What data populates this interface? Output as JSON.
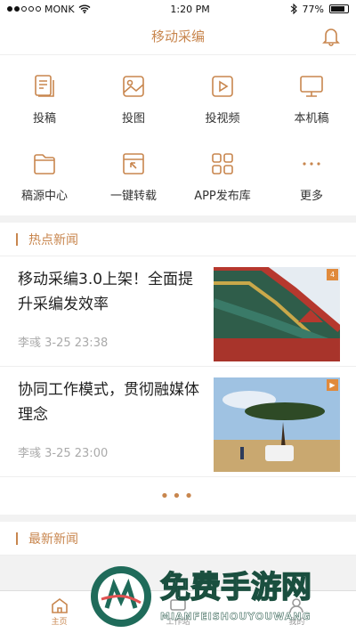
{
  "status": {
    "carrier": "MONK",
    "time": "1:20 PM",
    "battery": "77%",
    "battery_level": 0.77
  },
  "header": {
    "title": "移动采编"
  },
  "grid": [
    {
      "label": "投稿",
      "icon": "document-edit-icon"
    },
    {
      "label": "投图",
      "icon": "image-icon"
    },
    {
      "label": "投视频",
      "icon": "video-play-icon"
    },
    {
      "label": "本机稿",
      "icon": "monitor-icon"
    },
    {
      "label": "稿源中心",
      "icon": "folder-icon"
    },
    {
      "label": "一键转载",
      "icon": "repost-icon"
    },
    {
      "label": "APP发布库",
      "icon": "app-grid-icon"
    },
    {
      "label": "更多",
      "icon": "more-dots-icon"
    }
  ],
  "hot": {
    "title": "热点新闻",
    "items": [
      {
        "title": "移动采编3.0上架！全面提升采编发效率",
        "meta": "李彧 3-25 23:38",
        "badge": "4"
      },
      {
        "title": "协同工作模式，贯彻融媒体理念",
        "meta": "李彧 3-25 23:00",
        "badge": "▶"
      }
    ],
    "more": "•••"
  },
  "latest": {
    "title": "最新新闻"
  },
  "tabs": [
    {
      "label": "主页"
    },
    {
      "label": "工作站"
    },
    {
      "label": "我的"
    }
  ],
  "watermark": {
    "text": "免费手游网",
    "sub": "MIANFEISHOUYOUWANG"
  },
  "colors": {
    "accent": "#c8864e"
  }
}
